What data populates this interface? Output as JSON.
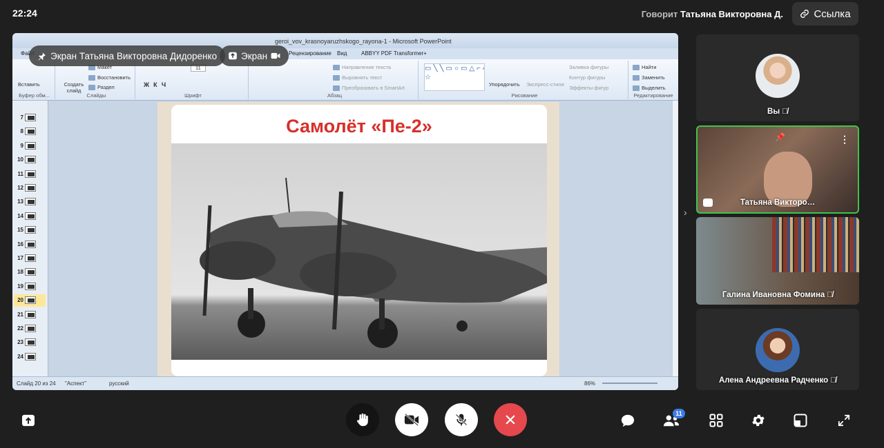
{
  "topbar": {
    "time": "22:24",
    "speaking_label": "Говорит",
    "speaker_name": "Татьяна Викторовна Д.",
    "link_label": "Ссылка"
  },
  "share": {
    "screen_owner_label": "Экран Татьяна Викторовна Дидоренко",
    "screen_chip_label": "Экран",
    "window_title": "geroi_vov_krasnoyaruzhskogo_rayona-1 - Microsoft PowerPoint",
    "tabs": [
      "Файл",
      "Рецензирование",
      "Вид",
      "ABBYY PDF Transformer+"
    ],
    "ribbon": {
      "groups": [
        "Буфер обм...",
        "Слайды",
        "Шрифт",
        "Абзац",
        "Рисование",
        "Редактирование"
      ],
      "paste": "Вставить",
      "create_slide": "Создать слайд",
      "layout": "Макет",
      "restore": "Восстановить",
      "section": "Раздел",
      "text_direction": "Направление текста",
      "align_text": "Выровнять текст",
      "smartart": "Преобразовать в SmartArt",
      "arrange": "Упорядочить",
      "express_styles": "Экспресс-стили",
      "shape_fill": "Заливка фигуры",
      "shape_outline": "Контур фигуры",
      "shape_effects": "Эффекты фигур",
      "find": "Найти",
      "replace": "Заменить",
      "select": "Выделить",
      "font_size": "11"
    },
    "slide_numbers": [
      "7",
      "8",
      "9",
      "10",
      "11",
      "12",
      "13",
      "14",
      "15",
      "16",
      "17",
      "18",
      "19",
      "20",
      "21",
      "22",
      "23",
      "24"
    ],
    "active_slide": "20",
    "slide_title": "Самолёт «Пе-2»",
    "status": {
      "slide_info": "Слайд 20 из 24",
      "theme": "\"Аспект\"",
      "language": "русский",
      "zoom": "86%"
    }
  },
  "participants": [
    {
      "name": "Вы",
      "muted": true
    },
    {
      "name": "Татьяна Викторо…",
      "muted": false
    },
    {
      "name": "Галина Ивановна Фомина",
      "muted": true
    },
    {
      "name": "Алена Андреевна Радченко",
      "muted": true
    }
  ],
  "controls": {
    "participants_count": "11"
  },
  "colors": {
    "active_speaker_border": "#3fc44b",
    "end_call": "#e5484d",
    "slide_title": "#d6302a",
    "badge": "#3d7be6"
  }
}
